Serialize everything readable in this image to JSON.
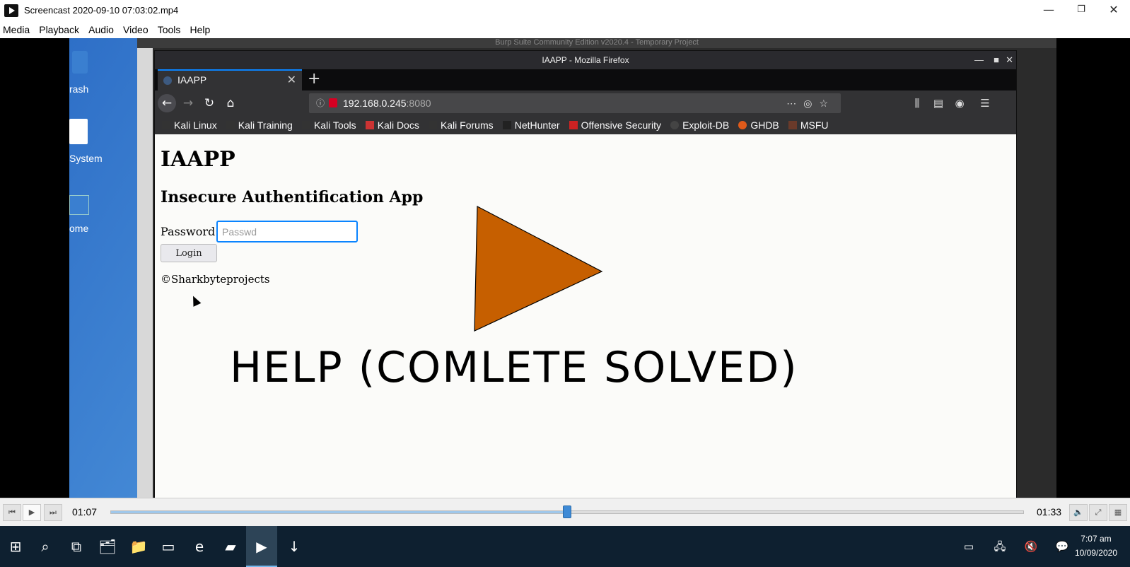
{
  "vlc": {
    "window_title": "Screencast 2020-09-10 07:03:02.mp4",
    "menu": [
      "Media",
      "Playback",
      "Audio",
      "Video",
      "Tools",
      "Help"
    ],
    "time_elapsed": "01:07",
    "time_total": "01:33",
    "progress_fraction": 0.5
  },
  "desktop": {
    "icons": [
      "rash",
      "System",
      "ome"
    ]
  },
  "burp": {
    "title": "Burp Suite Community Edition v2020.4 - Temporary Project"
  },
  "firefox": {
    "window_title": "IAAPP - Mozilla Firefox",
    "tab_label": "IAAPP",
    "url_host": "192.168.0.245",
    "url_port": ":8080",
    "bookmarks": [
      "Kali Linux",
      "Kali Training",
      "Kali Tools",
      "Kali Docs",
      "Kali Forums",
      "NetHunter",
      "Offensive Security",
      "Exploit-DB",
      "GHDB",
      "MSFU"
    ]
  },
  "page": {
    "h1": "IAAPP",
    "h2": "Insecure Authentification App",
    "password_label": "Password:",
    "password_placeholder": "Passwd",
    "login_label": "Login",
    "copyright": "©Sharkbyteprojects",
    "overlay_text": "HELP (COMLETE SOLVED)",
    "play_color": "#c65f00"
  },
  "taskbar": {
    "time": "7:07 am",
    "date": "10/09/2020"
  }
}
